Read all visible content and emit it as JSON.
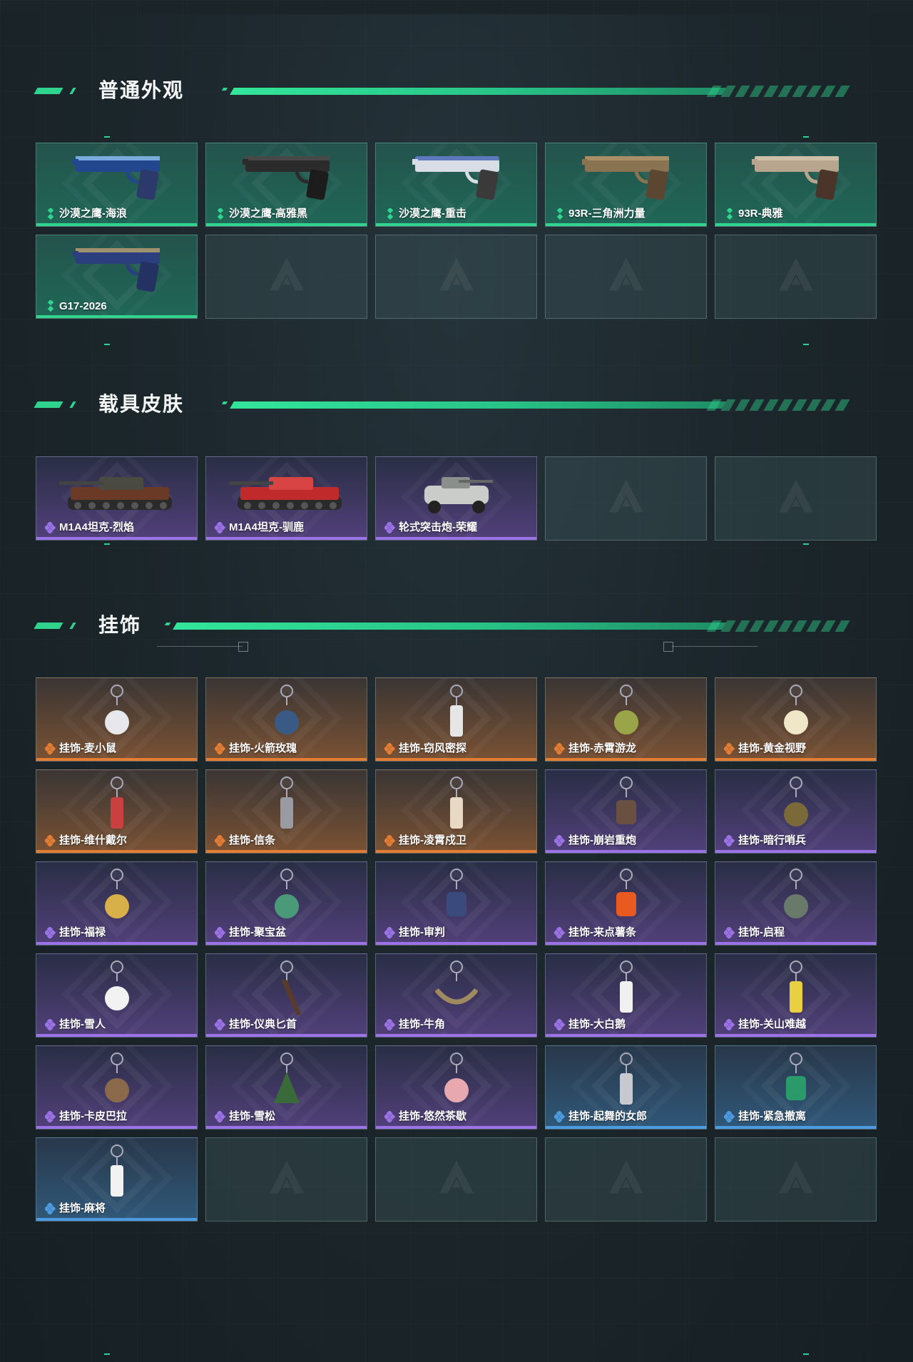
{
  "sections": {
    "weapons": {
      "title": "普通外观",
      "items": [
        {
          "name": "沙漠之鹰-海浪",
          "rarity": "green",
          "icon": "pistol-blue-wave"
        },
        {
          "name": "沙漠之鹰-高雅黑",
          "rarity": "green",
          "icon": "pistol-black"
        },
        {
          "name": "沙漠之鹰-重击",
          "rarity": "green",
          "icon": "pistol-white-blue"
        },
        {
          "name": "93R-三角洲力量",
          "rarity": "green",
          "icon": "pistol-tan"
        },
        {
          "name": "93R-典雅",
          "rarity": "green",
          "icon": "pistol-beige"
        },
        {
          "name": "G17-2026",
          "rarity": "green",
          "icon": "pistol-blue-gold"
        }
      ]
    },
    "vehicles": {
      "title": "载具皮肤",
      "items": [
        {
          "name": "M1A4坦克-烈焰",
          "rarity": "purple",
          "icon": "tank-flame"
        },
        {
          "name": "M1A4坦克-驯鹿",
          "rarity": "purple",
          "icon": "tank-reindeer"
        },
        {
          "name": "轮式突击炮-荣耀",
          "rarity": "purple",
          "icon": "wheeled-assault-gun"
        }
      ]
    },
    "charms": {
      "title": "挂饰",
      "items": [
        {
          "name": "挂饰-麦小鼠",
          "rarity": "orange",
          "icon": "mouse-charm"
        },
        {
          "name": "挂饰-火箭玫瑰",
          "rarity": "orange",
          "icon": "rocket-rose-charm"
        },
        {
          "name": "挂饰-窃风密探",
          "rarity": "orange",
          "icon": "rabbit-spy-charm"
        },
        {
          "name": "挂饰-赤霄游龙",
          "rarity": "orange",
          "icon": "dragon-charm"
        },
        {
          "name": "挂饰-黄金视野",
          "rarity": "orange",
          "icon": "golden-vision-charm"
        },
        {
          "name": "挂饰-维什戴尔",
          "rarity": "orange",
          "icon": "wisadel-charm"
        },
        {
          "name": "挂饰-信条",
          "rarity": "orange",
          "icon": "creed-charm"
        },
        {
          "name": "挂饰-凌霄戍卫",
          "rarity": "orange",
          "icon": "guard-charm"
        },
        {
          "name": "挂饰-崩岩重炮",
          "rarity": "purple",
          "icon": "rock-cannon-charm"
        },
        {
          "name": "挂饰-暗行哨兵",
          "rarity": "purple",
          "icon": "sentinel-charm"
        },
        {
          "name": "挂饰-福禄",
          "rarity": "purple",
          "icon": "gourd-charm"
        },
        {
          "name": "挂饰-聚宝盆",
          "rarity": "purple",
          "icon": "treasure-bowl-charm"
        },
        {
          "name": "挂饰-审判",
          "rarity": "purple",
          "icon": "judgement-card-charm"
        },
        {
          "name": "挂饰-来点薯条",
          "rarity": "purple",
          "icon": "fries-charm"
        },
        {
          "name": "挂饰-启程",
          "rarity": "purple",
          "icon": "departure-ring-charm"
        },
        {
          "name": "挂饰-雪人",
          "rarity": "purple",
          "icon": "snowman-charm"
        },
        {
          "name": "挂饰-仪典匕首",
          "rarity": "purple",
          "icon": "dagger-charm"
        },
        {
          "name": "挂饰-牛角",
          "rarity": "purple",
          "icon": "horns-charm"
        },
        {
          "name": "挂饰-大白鹅",
          "rarity": "purple",
          "icon": "goose-charm"
        },
        {
          "name": "挂饰-关山难越",
          "rarity": "purple",
          "icon": "yellow-tube-charm"
        },
        {
          "name": "挂饰-卡皮巴拉",
          "rarity": "purple",
          "icon": "capybara-charm"
        },
        {
          "name": "挂饰-雪松",
          "rarity": "purple",
          "icon": "cedar-tree-charm"
        },
        {
          "name": "挂饰-悠然茶歇",
          "rarity": "purple",
          "icon": "cupcake-charm"
        },
        {
          "name": "挂饰-起舞的女郎",
          "rarity": "blue",
          "icon": "dancer-charm"
        },
        {
          "name": "挂饰-紧急撤离",
          "rarity": "blue",
          "icon": "emergency-exit-charm"
        },
        {
          "name": "挂饰-麻将",
          "rarity": "blue",
          "icon": "mahjong-charm"
        }
      ]
    }
  },
  "colors": {
    "accent": "#2fd38d",
    "green": "#31d48f",
    "purple": "#9c73e6",
    "orange": "#e47d34",
    "blue": "#4c9be0"
  }
}
